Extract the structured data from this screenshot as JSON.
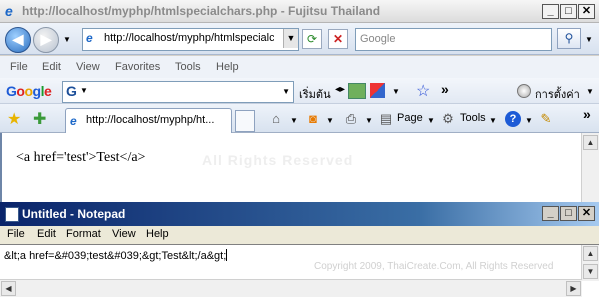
{
  "ie": {
    "title": "http://localhost/myphp/htmlspecialchars.php - Fujitsu Thailand",
    "address": "http://localhost/myphp/htmlspecialch",
    "search_placeholder": "Google",
    "menu": [
      "File",
      "Edit",
      "View",
      "Favorites",
      "Tools",
      "Help"
    ],
    "google_logo": "Google",
    "google_box_letter": "G",
    "google_search_label": "เริ่มต้น",
    "google_settings_label": "การตั้งค่า",
    "tab_label": "http://localhost/myphp/ht...",
    "page_label": "Page",
    "tools_label": "Tools",
    "content_text": "<a href='test'>Test</a>",
    "watermark": "All Rights Reserved"
  },
  "notepad": {
    "title": "Untitled - Notepad",
    "menu": [
      "File",
      "Edit",
      "Format",
      "View",
      "Help"
    ],
    "text": "&lt;a href=&#039;test&#039;&gt;Test&lt;/a&gt;",
    "copyright": "Copyright 2009, ThaiCreate.Com, All Rights Reserved"
  },
  "colors": {
    "accent": "#1d68c8",
    "notepad_title": "#0a246a"
  }
}
